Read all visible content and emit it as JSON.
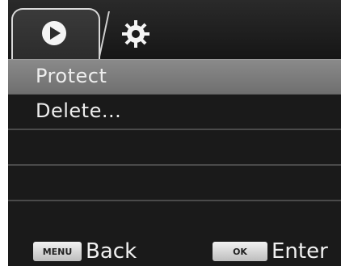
{
  "tabs": [
    {
      "icon": "play-icon",
      "active": true
    },
    {
      "icon": "gear-icon",
      "active": false
    }
  ],
  "menu": {
    "items": [
      {
        "label": "Protect",
        "selected": true
      },
      {
        "label": "Delete...",
        "selected": false
      },
      {
        "label": "",
        "selected": false
      },
      {
        "label": "",
        "selected": false
      },
      {
        "label": "",
        "selected": false
      }
    ]
  },
  "footer": {
    "menu_key": "MENU",
    "back_label": "Back",
    "ok_key": "OK",
    "enter_label": "Enter"
  },
  "colors": {
    "background": "#1a1a1a",
    "selected_row": "#7d7d7d",
    "text": "#eeeeee"
  }
}
